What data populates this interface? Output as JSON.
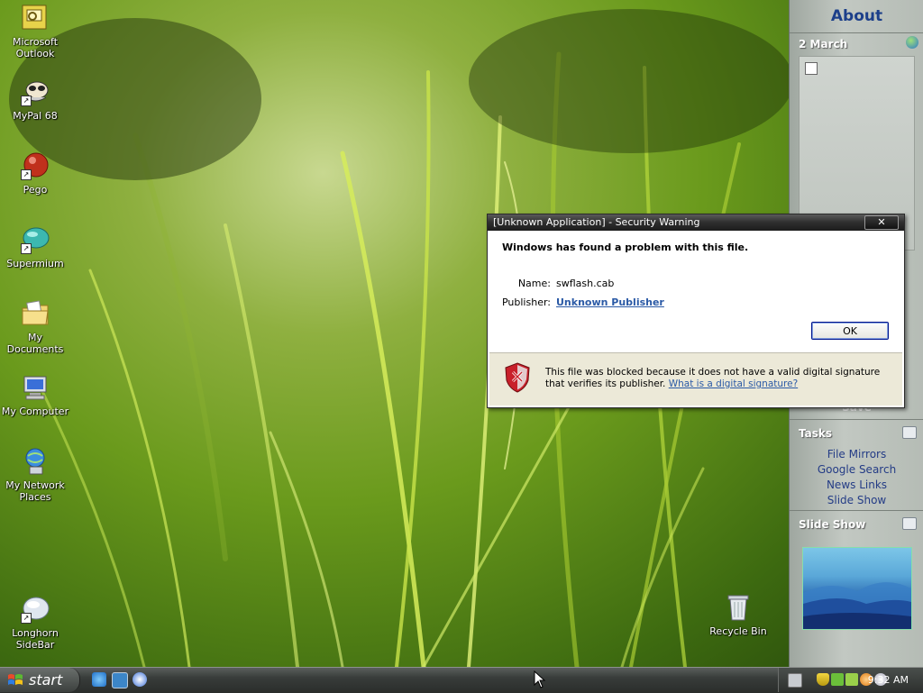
{
  "desktop": {
    "icons": [
      {
        "label": "Microsoft Outlook",
        "icon": "outlook-icon"
      },
      {
        "label": "MyPal 68",
        "icon": "mypal-icon"
      },
      {
        "label": "Pego",
        "icon": "pego-icon"
      },
      {
        "label": "Supermium",
        "icon": "supermium-icon"
      },
      {
        "label": "My Documents",
        "icon": "folder-documents-icon"
      },
      {
        "label": "My Computer",
        "icon": "computer-icon"
      },
      {
        "label": "My Network Places",
        "icon": "network-icon"
      },
      {
        "label": "Longhorn SideBar",
        "icon": "sidebar-icon"
      },
      {
        "label": "Recycle Bin",
        "icon": "recycle-bin-icon"
      }
    ]
  },
  "sidebar": {
    "title": "About",
    "date_header": "2 March",
    "tasks_header": "Tasks",
    "tasks": [
      "File Mirrors",
      "Google Search",
      "News Links",
      "Slide Show"
    ],
    "slideshow_header": "Slide Show",
    "partial_label": "Save"
  },
  "dialog": {
    "title": "[Unknown Application] - Security Warning",
    "close_label": "✕",
    "heading": "Windows has found a problem with this file.",
    "name_label": "Name:",
    "name_value": "swflash.cab",
    "publisher_label": "Publisher:",
    "publisher_value": "Unknown Publisher",
    "ok_label": "OK",
    "footer_text": "This file was blocked because it does not have a valid digital signature that verifies its publisher.",
    "footer_link": "What is a digital signature?"
  },
  "taskbar": {
    "start_label": "start",
    "clock": "9:32 AM"
  },
  "colors": {
    "link": "#2b5aa6",
    "sidebar_title": "#1c3f8a",
    "task_text": "#243c86"
  }
}
